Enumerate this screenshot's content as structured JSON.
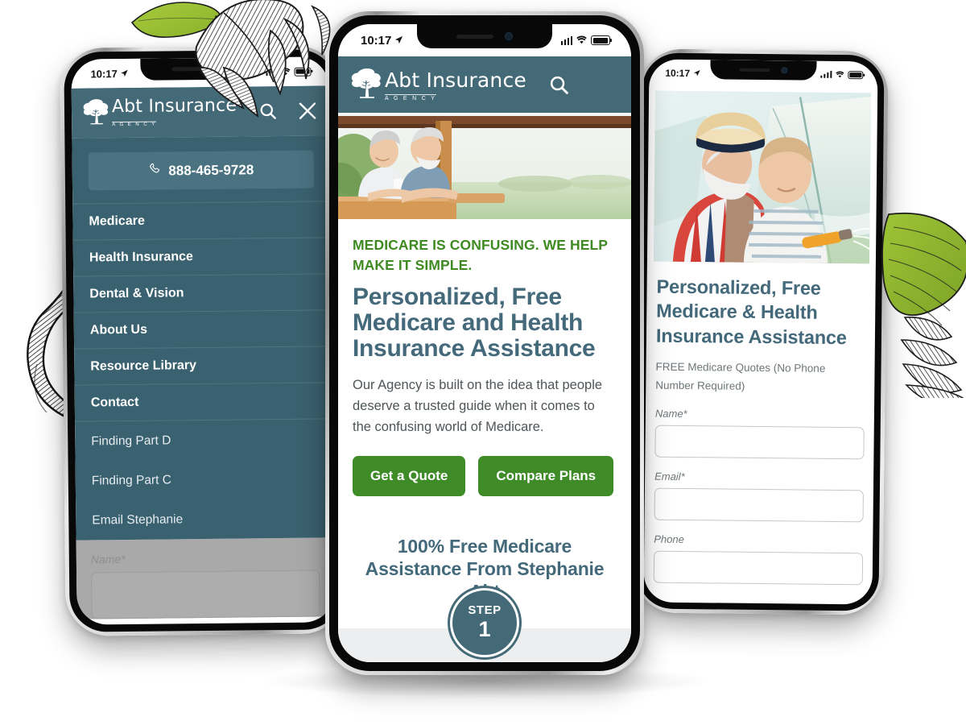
{
  "brand": {
    "name": "Abt Insurance",
    "subtitle": "A G E N C Y",
    "teal": "#456a77",
    "green": "#3e8b28",
    "heading_color": "#43697a",
    "leaf_green": "#9cc43a"
  },
  "status_bar": {
    "time": "10:17",
    "location_arrow": "location-arrow-icon",
    "signal": "cellular-signal-icon",
    "wifi": "wifi-icon",
    "battery": "battery-icon"
  },
  "left_phone": {
    "header": {
      "logo_name": "Abt Insurance",
      "logo_sub": "A G E N C Y",
      "search_icon": "search-icon",
      "close_icon": "close-icon"
    },
    "call_button": {
      "phone_icon": "phone-icon",
      "number": "888-465-9728"
    },
    "primary_menu": [
      "Medicare",
      "Health Insurance",
      "Dental & Vision",
      "About Us",
      "Resource Library",
      "Contact"
    ],
    "secondary_menu": [
      "Finding Part D",
      "Finding Part C",
      "Email Stephanie"
    ],
    "dimmed_page": {
      "field_label": "Name*"
    }
  },
  "center_phone": {
    "header": {
      "logo_name": "Abt Insurance",
      "logo_sub": "A G E N C Y",
      "search_icon": "search-icon",
      "menu_icon": "hamburger-menu-icon"
    },
    "hero_image_alt": "senior couple smiling on a wooden porch",
    "eyebrow": "MEDICARE IS CONFUSING. WE HELP MAKE IT SIMPLE.",
    "headline": "Personalized, Free Medicare and Health Insurance Assistance",
    "paragraph": "Our Agency is built on the idea that people deserve a trusted guide when it comes to the confusing world of Medicare.",
    "buttons": {
      "primary": "Get a Quote",
      "secondary": "Compare Plans"
    },
    "claim": "100% Free Medicare Assistance From Stephanie Abt",
    "step_badge": {
      "word": "STEP",
      "number": "1"
    }
  },
  "right_phone": {
    "hero_image_alt": "grandfather in straw hat with young boy holding a garden hose",
    "headline": "Personalized, Free Medicare & Health Insurance Assistance",
    "subtext": "FREE Medicare Quotes (No Phone Number Required)",
    "form": {
      "fields": [
        {
          "label": "Name*",
          "value": ""
        },
        {
          "label": "Email*",
          "value": ""
        },
        {
          "label": "Phone",
          "value": ""
        }
      ]
    }
  },
  "decor": {
    "top_leaf": "botanical-leaf-illustration",
    "right_leaf": "botanical-leaf-illustration",
    "left_vine": "botanical-vine-illustration"
  }
}
